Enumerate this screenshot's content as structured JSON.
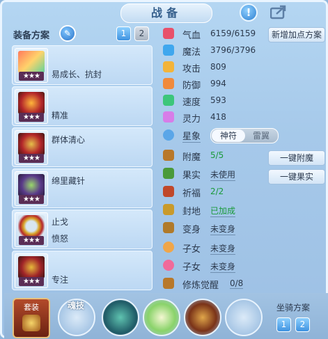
{
  "window": {
    "title": "战备"
  },
  "plans": {
    "label": "装备方案",
    "tabs": [
      "1",
      "2"
    ],
    "active_tab": "1"
  },
  "equipment": [
    {
      "name": "易成长、抗封",
      "name2": "",
      "stars": "★★★",
      "icon": "sword-icon"
    },
    {
      "name": "精准",
      "name2": "",
      "stars": "★★★",
      "icon": "helmet-icon"
    },
    {
      "name": "群体清心",
      "name2": "",
      "stars": "★★★",
      "icon": "armor-icon"
    },
    {
      "name": "绵里藏针",
      "name2": "",
      "stars": "★★★",
      "icon": "cloak-icon"
    },
    {
      "name": "止戈",
      "name2": "愤怒",
      "stars": "★★★",
      "icon": "belt-icon"
    },
    {
      "name": "专注",
      "name2": "",
      "stars": "★★★",
      "icon": "boots-icon"
    }
  ],
  "stats": [
    {
      "label": "气血",
      "value": "6159/6159",
      "color": "#e8516a"
    },
    {
      "label": "魔法",
      "value": "3796/3796",
      "color": "#3fa7ee"
    },
    {
      "label": "攻击",
      "value": "809",
      "color": "#f3b43a"
    },
    {
      "label": "防御",
      "value": "994",
      "color": "#f08a3c"
    },
    {
      "label": "速度",
      "value": "593",
      "color": "#3cc67b"
    },
    {
      "label": "灵力",
      "value": "418",
      "color": "#d77de8"
    }
  ],
  "add_points_label": "新增加点方案",
  "star_sign": {
    "label": "星象",
    "options": [
      "神符",
      "雷翼"
    ],
    "active": "神符"
  },
  "extras": [
    {
      "label": "附魔",
      "value": "5/5",
      "green": true
    },
    {
      "label": "果实",
      "value": "未使用",
      "green": false
    },
    {
      "label": "祈福",
      "value": "2/2",
      "green": true
    },
    {
      "label": "封地",
      "value": "已加成",
      "green": true
    },
    {
      "label": "变身",
      "value": "未变身",
      "green": false
    },
    {
      "label": "子女",
      "value": "未变身",
      "green": false
    },
    {
      "label": "子女",
      "value": "未变身",
      "green": false
    },
    {
      "label": "修炼觉醒",
      "value": "0/8",
      "green": false
    }
  ],
  "side_buttons": {
    "enchant": "一键附魔",
    "fruit": "一键果实"
  },
  "bottom": {
    "suit_label": "套装",
    "skill_label": "魂技",
    "mount_label": "坐骑方案",
    "mount_tabs": [
      "1",
      "2"
    ]
  }
}
